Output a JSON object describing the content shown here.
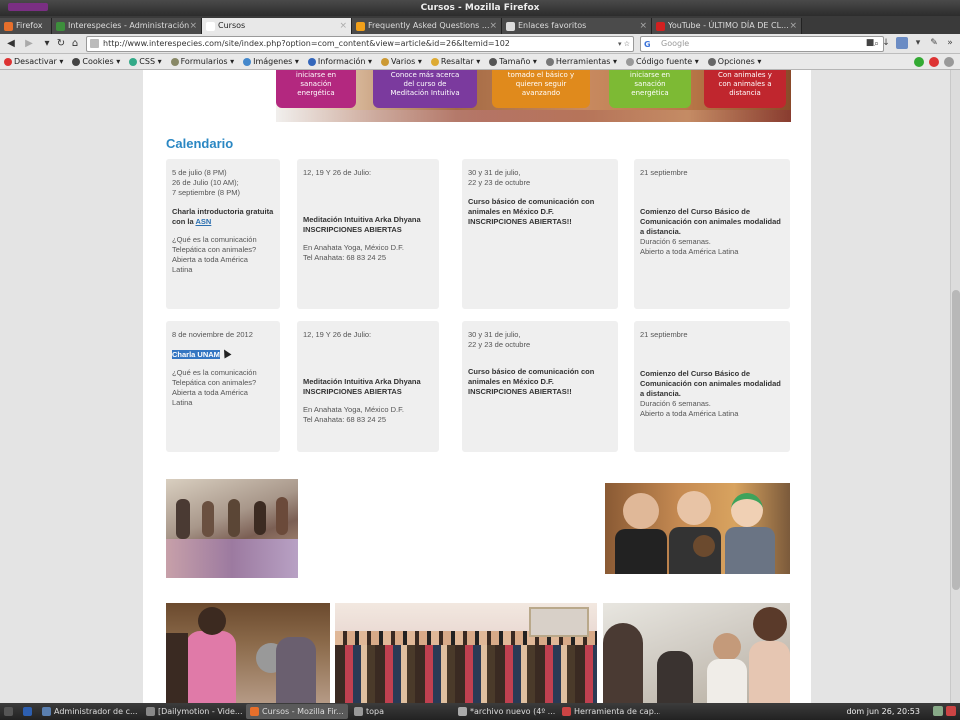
{
  "window": {
    "title": "Cursos - Mozilla Firefox"
  },
  "tabs": [
    {
      "label": "Firefox",
      "active": false,
      "fav": "#e76f2b"
    },
    {
      "label": "Interespecies - Administración",
      "active": false,
      "fav": "#3d8f3c"
    },
    {
      "label": "Cursos",
      "active": true,
      "fav": "#ffffff"
    },
    {
      "label": "Frequently Asked Questions ...",
      "active": false,
      "fav": "#f1a01a"
    },
    {
      "label": "Enlaces favoritos",
      "active": false,
      "fav": "#dddddd"
    },
    {
      "label": "YouTube - ÚLTIMO DÍA DE CL...",
      "active": false,
      "fav": "#d32020"
    }
  ],
  "nav": {
    "url": "http://www.interespecies.com/site/index.php?option=com_content&view=article&id=26&Itemid=102",
    "search_placeholder": "Google",
    "search_logo": "G"
  },
  "devtoolbar": {
    "items": [
      {
        "label": "Desactivar ▾",
        "color": "#d33"
      },
      {
        "label": "Cookies ▾",
        "color": "#444"
      },
      {
        "label": "CSS ▾",
        "color": "#3a8"
      },
      {
        "label": "Formularios ▾",
        "color": "#886"
      },
      {
        "label": "Imágenes ▾",
        "color": "#48c"
      },
      {
        "label": "Información ▾",
        "color": "#36b"
      },
      {
        "label": "Varios ▾",
        "color": "#c93"
      },
      {
        "label": "Resaltar ▾",
        "color": "#da3"
      },
      {
        "label": "Tamaño ▾",
        "color": "#555"
      },
      {
        "label": "Herramientas ▾",
        "color": "#777"
      },
      {
        "label": "Código fuente ▾",
        "color": "#999"
      },
      {
        "label": "Opciones ▾",
        "color": "#666"
      }
    ]
  },
  "banner": {
    "tiles": [
      {
        "text": "iniciarse en\nsanación\nenergética",
        "color": "#b3287f"
      },
      {
        "text": "Conoce más acerca\ndel curso de\nMeditación Intuitiva",
        "color": "#7b3a9e"
      },
      {
        "text": "tomado el básico y\nquieren seguir\navanzando",
        "color": "#e08a1c"
      },
      {
        "text": "iniciarse en\nsanación\nenergética",
        "color": "#7dba34"
      },
      {
        "text": "Con animales y\ncon animales a\ndistancia",
        "color": "#c0262e"
      }
    ]
  },
  "calendar": {
    "title": "Calendario",
    "row1": [
      {
        "dates": "5 de julio (8 PM)\n26 de Julio (10 AM);\n7 septiembre (8 PM)",
        "headline_pre": "Charla introductoria gratuita con la ",
        "headline_link": "ASN",
        "desc": "¿Qué es la comunicación\nTelepática con animales?\nAbierta a toda América\nLatina"
      },
      {
        "dates": "12, 19 Y 26 de Julio:",
        "headline": "Meditación Intuitiva Arka Dhyana INSCRIPCIONES ABIERTAS",
        "desc": "En Anahata Yoga, México D.F.\nTel Anahata: 68 83 24 25"
      },
      {
        "dates": "30 y 31 de julio,\n22 y 23 de octubre",
        "headline": "Curso básico de comunicación con animales en México D.F. INSCRIPCIONES ABIERTAS!!"
      },
      {
        "dates": "21 septiembre",
        "headline": "Comienzo del Curso Básico de Comunicación con animales modalidad a distancia.",
        "desc": "Duración 6 semanas.\nAbierto a toda América Latina"
      }
    ],
    "row2": [
      {
        "dates": "8 de noviembre de 2012",
        "headline_sel": "Charla UNAM",
        "desc": "¿Qué es la comunicación\nTelepática con animales?\nAbierta a toda América\nLatina"
      },
      {
        "dates": "12, 19 Y 26 de Julio:",
        "headline": "Meditación Intuitiva Arka Dhyana INSCRIPCIONES ABIERTAS",
        "desc": "En Anahata Yoga, México D.F.\nTel Anahata: 68 83 24 25"
      },
      {
        "dates": "30 y 31 de julio,\n22 y 23 de octubre",
        "headline": "Curso básico de comunicación con animales en México D.F. INSCRIPCIONES ABIERTAS!!"
      },
      {
        "dates": "21 septiembre",
        "headline": "Comienzo del Curso Básico de Comunicación con animales modalidad a distancia.",
        "desc": "Duración 6 semanas.\nAbierto a toda América Latina"
      }
    ]
  },
  "taskbar": {
    "tasks": [
      {
        "label": "Administrador de c...",
        "color": "#5a7fb0"
      },
      {
        "label": "[Dailymotion - Vide...",
        "color": "#888"
      },
      {
        "label": "Cursos - Mozilla Fir...",
        "color": "#e76f2b",
        "active": true
      },
      {
        "label": "topa",
        "color": "#999"
      },
      {
        "label": "*archivo nuevo (4º ...",
        "color": "#aaa"
      },
      {
        "label": "Herramienta de cap...",
        "color": "#c44"
      }
    ],
    "clock": "dom jun 26, 20:53"
  }
}
